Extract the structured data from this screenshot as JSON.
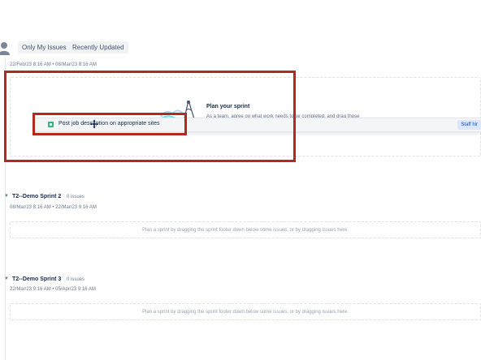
{
  "toolbar": {
    "filters": [
      "Only My Issues",
      "Recently Updated"
    ]
  },
  "sprint_1": {
    "dates": "22/Feb/23 8:16 AM  •  08/Mar/23 8:16 AM",
    "plan_title": "Plan your sprint",
    "plan_text": "As a team, agree on what work needs to be completed, and drag those",
    "dragged_issue": {
      "summary": "Post job description on appropriate sites",
      "badge": "Staff hir"
    }
  },
  "sprints": [
    {
      "name": "T2--Demo Sprint 2",
      "count": "0 issues",
      "dates": "08/Mar/23 8:16 AM  •  22/Mar/23 9:16 AM",
      "empty_text": "Plan a sprint by dragging the sprint footer down below some issues, or by dragging issues here."
    },
    {
      "name": "T2--Demo Sprint 3",
      "count": "0 issues",
      "dates": "22/Mar/23 9:16 AM  •  05/Apr/23 9:16 AM",
      "empty_text": "Plan a sprint by dragging the sprint footer down below some issues, or by dragging issues here."
    }
  ],
  "colors": {
    "highlight": "#b22a1e",
    "story": "#36b37e",
    "badge_bg": "#dde7fb",
    "badge_text": "#0052cc"
  },
  "icons": [
    "user-avatar-icon",
    "sprint-illustration-icon",
    "story-icon",
    "move-cursor-icon",
    "chevron-down-icon"
  ]
}
